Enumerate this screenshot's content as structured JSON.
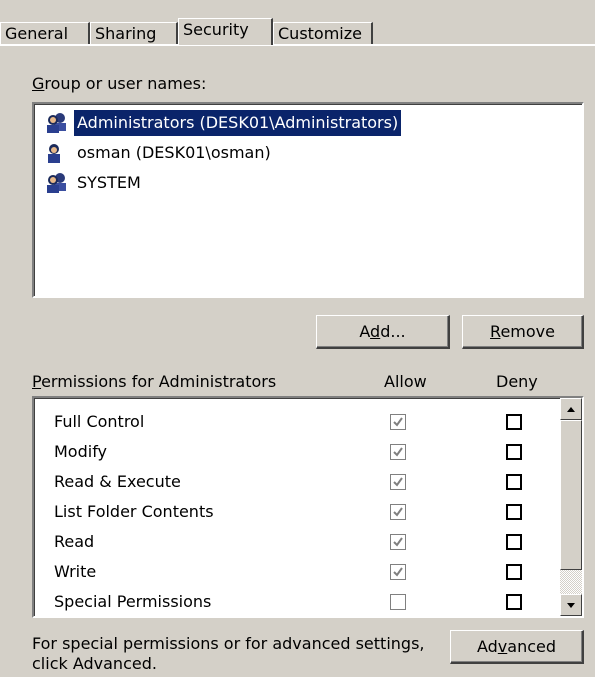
{
  "tabs": [
    "General",
    "Sharing",
    "Security",
    "Customize"
  ],
  "active_tab": "Security",
  "group_label": {
    "accel": "G",
    "rest": "roup or user names:"
  },
  "users": [
    {
      "name": "Administrators (DESK01\\Administrators)",
      "icon": "group-icon",
      "selected": true
    },
    {
      "name": "osman (DESK01\\osman)",
      "icon": "user-icon",
      "selected": false
    },
    {
      "name": "SYSTEM",
      "icon": "group-icon",
      "selected": false
    }
  ],
  "buttons": {
    "add": {
      "pre": "A",
      "accel": "d",
      "post": "d..."
    },
    "remove": {
      "pre": "",
      "accel": "R",
      "post": "emove"
    },
    "advanced": {
      "pre": "Ad",
      "accel": "v",
      "post": "anced"
    }
  },
  "permissions_label": {
    "accel": "P",
    "rest": "ermissions for Administrators"
  },
  "col_allow": "Allow",
  "col_deny": "Deny",
  "permissions": [
    {
      "name": "Full Control",
      "allow": true,
      "deny": false
    },
    {
      "name": "Modify",
      "allow": true,
      "deny": false
    },
    {
      "name": "Read & Execute",
      "allow": true,
      "deny": false
    },
    {
      "name": "List Folder Contents",
      "allow": true,
      "deny": false
    },
    {
      "name": "Read",
      "allow": true,
      "deny": false
    },
    {
      "name": "Write",
      "allow": true,
      "deny": false
    },
    {
      "name": "Special Permissions",
      "allow": false,
      "deny": false
    }
  ],
  "footer_text_1": "For special permissions or for advanced settings,",
  "footer_text_2": "click Advanced.",
  "colors": {
    "selection": "#0a246a",
    "face": "#d4d0c8"
  }
}
